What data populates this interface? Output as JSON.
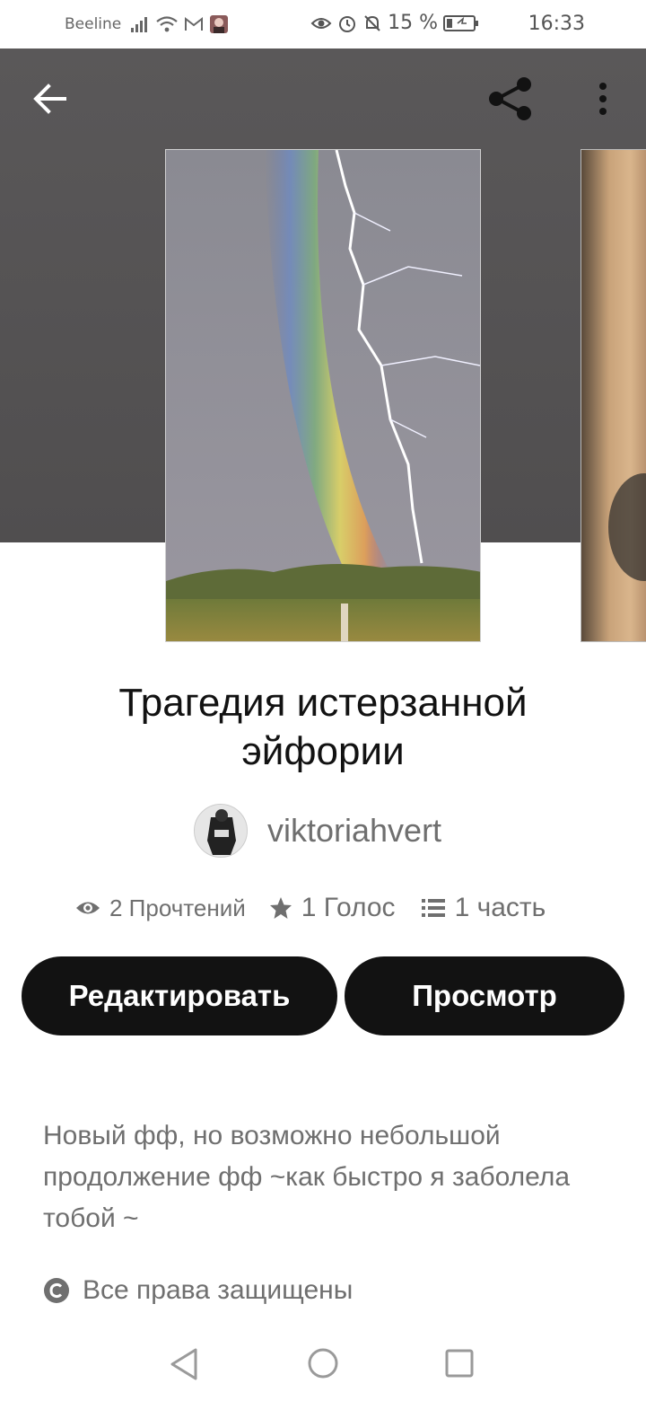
{
  "status_bar": {
    "carrier": "Beeline",
    "battery": "15 %",
    "time": "16:33"
  },
  "story": {
    "title_line1": "Трагедия истерзанной",
    "title_line2": "эйфории",
    "author": "viktoriahvert",
    "reads": "2 Прочтений",
    "votes": "1 Голос",
    "parts": "1 часть",
    "description": "Новый фф, но возможно небольшой продолжение фф ~как быстро я заболела тобой ~",
    "rights": "Все права защищены"
  },
  "actions": {
    "edit_label": "Редактировать",
    "view_label": "Просмотр"
  },
  "icons": {
    "back": "arrow-left-icon",
    "share": "share-icon",
    "more": "more-vertical-icon",
    "reads": "eye-icon",
    "votes": "star-icon",
    "parts": "list-icon",
    "rights": "copyright-icon"
  },
  "colors": {
    "header": "#545253",
    "button": "#121212",
    "muted_text": "#6f6f6f"
  }
}
